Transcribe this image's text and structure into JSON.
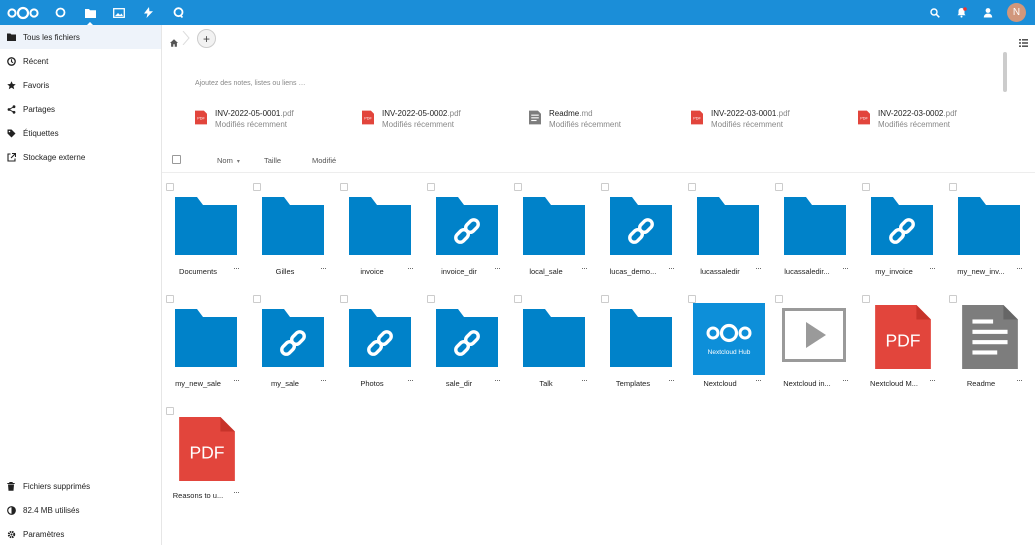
{
  "topbar": {
    "apps": [
      {
        "icon": "nextcloud-logo-icon"
      },
      {
        "icon": "dashboard-icon"
      },
      {
        "icon": "files-icon",
        "active": true
      },
      {
        "icon": "photos-icon"
      },
      {
        "icon": "activity-icon"
      },
      {
        "icon": "talk-icon"
      }
    ],
    "right_icons": [
      "search-icon",
      "notifications-icon",
      "contacts-icon"
    ],
    "avatar_initial": "N",
    "brand_color": "#1b8ed8"
  },
  "sidebar": {
    "items": [
      {
        "label": "Tous les fichiers",
        "icon": "folder-icon",
        "active": true
      },
      {
        "label": "Récent",
        "icon": "clock-icon"
      },
      {
        "label": "Favoris",
        "icon": "star-icon"
      },
      {
        "label": "Partages",
        "icon": "share-icon"
      },
      {
        "label": "Étiquettes",
        "icon": "tag-icon"
      },
      {
        "label": "Stockage externe",
        "icon": "external-icon"
      }
    ],
    "bottom": [
      {
        "label": "Fichiers supprimés",
        "icon": "trash-icon"
      },
      {
        "label": "82.4 MB utilisés",
        "icon": "quota-icon"
      },
      {
        "label": "Paramètres",
        "icon": "settings-icon"
      }
    ]
  },
  "breadcrumb": {
    "home_icon": "home-icon",
    "add_label": "+"
  },
  "notes_placeholder": "Ajoutez des notes, listes ou liens …",
  "recent": [
    {
      "name": "INV-2022-05-0001",
      "ext": ".pdf",
      "sub": "Modifiés récemment",
      "type": "pdf"
    },
    {
      "name": "INV-2022-05-0002",
      "ext": ".pdf",
      "sub": "Modifiés récemment",
      "type": "pdf"
    },
    {
      "name": "Readme",
      "ext": ".md",
      "sub": "Modifiés récemment",
      "type": "text"
    },
    {
      "name": "INV-2022-03-0001",
      "ext": ".pdf",
      "sub": "Modifiés récemment",
      "type": "pdf"
    },
    {
      "name": "INV-2022-03-0002",
      "ext": ".pdf",
      "sub": "Modifiés récemment",
      "type": "pdf"
    }
  ],
  "columns": {
    "name": "Nom",
    "size": "Taille",
    "modified": "Modifié"
  },
  "files": [
    {
      "name": "Documents",
      "type": "folder"
    },
    {
      "name": "Gilles",
      "type": "folder"
    },
    {
      "name": "invoice",
      "type": "folder"
    },
    {
      "name": "invoice_dir",
      "type": "link"
    },
    {
      "name": "local_sale",
      "type": "folder"
    },
    {
      "name": "lucas_demo...",
      "type": "link"
    },
    {
      "name": "lucassaledir",
      "type": "folder"
    },
    {
      "name": "lucassaledir...",
      "type": "folder"
    },
    {
      "name": "my_invoice",
      "type": "link"
    },
    {
      "name": "my_new_inv...",
      "type": "folder"
    },
    {
      "name": "my_new_sale",
      "type": "folder"
    },
    {
      "name": "my_sale",
      "type": "link"
    },
    {
      "name": "Photos",
      "type": "link"
    },
    {
      "name": "sale_dir",
      "type": "link"
    },
    {
      "name": "Talk",
      "type": "folder"
    },
    {
      "name": "Templates",
      "type": "folder"
    },
    {
      "name": "Nextcloud",
      "type": "nextcloud",
      "thumb_label": "Nextcloud Hub"
    },
    {
      "name": "Nextcloud in...",
      "type": "video"
    },
    {
      "name": "Nextcloud M...",
      "type": "pdf",
      "thumb_label": "PDF"
    },
    {
      "name": "Readme",
      "type": "text"
    },
    {
      "name": "Reasons to u...",
      "type": "pdf",
      "thumb_label": "PDF"
    }
  ],
  "colors": {
    "folder": "#0082c9",
    "pdf": "#e2453c",
    "text": "#7d7d7d"
  }
}
